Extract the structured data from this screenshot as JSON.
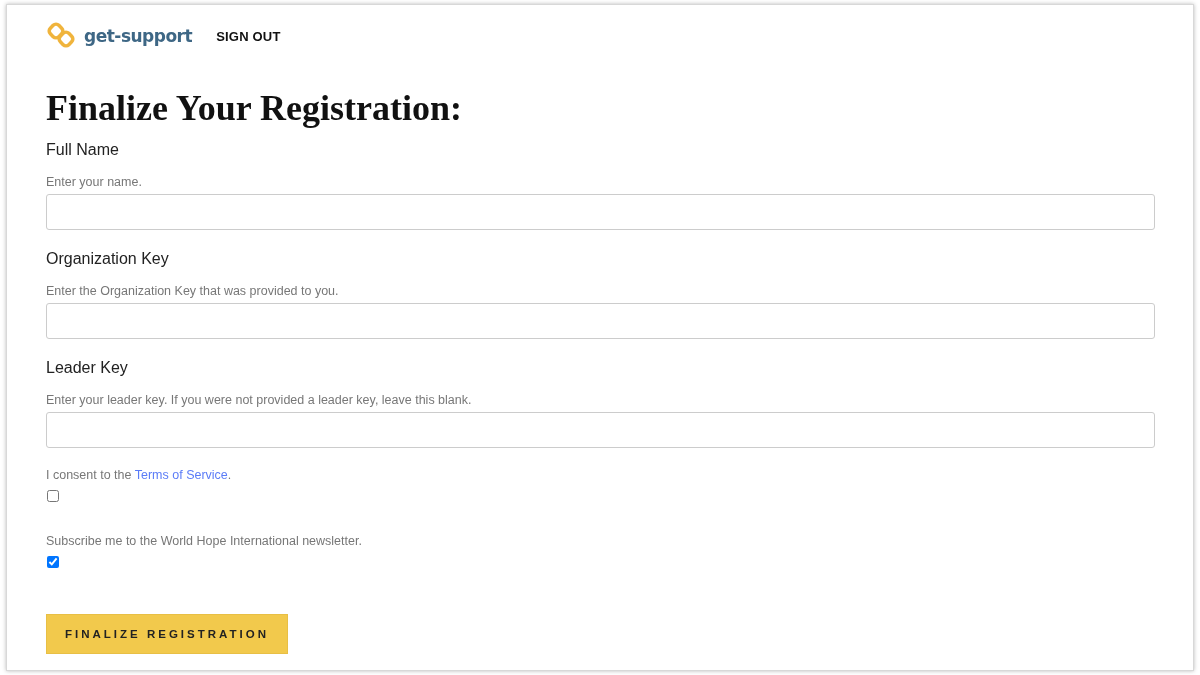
{
  "header": {
    "logo_text": "get-support",
    "nav": [
      "SIGN OUT"
    ]
  },
  "heading": "Finalize Your Registration:",
  "fields": [
    {
      "label": "Full Name",
      "help": "Enter your name."
    },
    {
      "label": "Organization Key",
      "help": "Enter the Organization Key that was provided to you."
    },
    {
      "label": "Leader Key",
      "help": "Enter your leader key. If you were not provided a leader key, leave this blank."
    }
  ],
  "checks": [
    {
      "text_before": "I consent to the ",
      "link": "Terms of Service",
      "text_after": ".",
      "checked": false
    },
    {
      "text_before": "Subscribe me to the World Hope International newsletter.",
      "checked": true
    }
  ],
  "submit": "FINALIZE REGISTRATION"
}
